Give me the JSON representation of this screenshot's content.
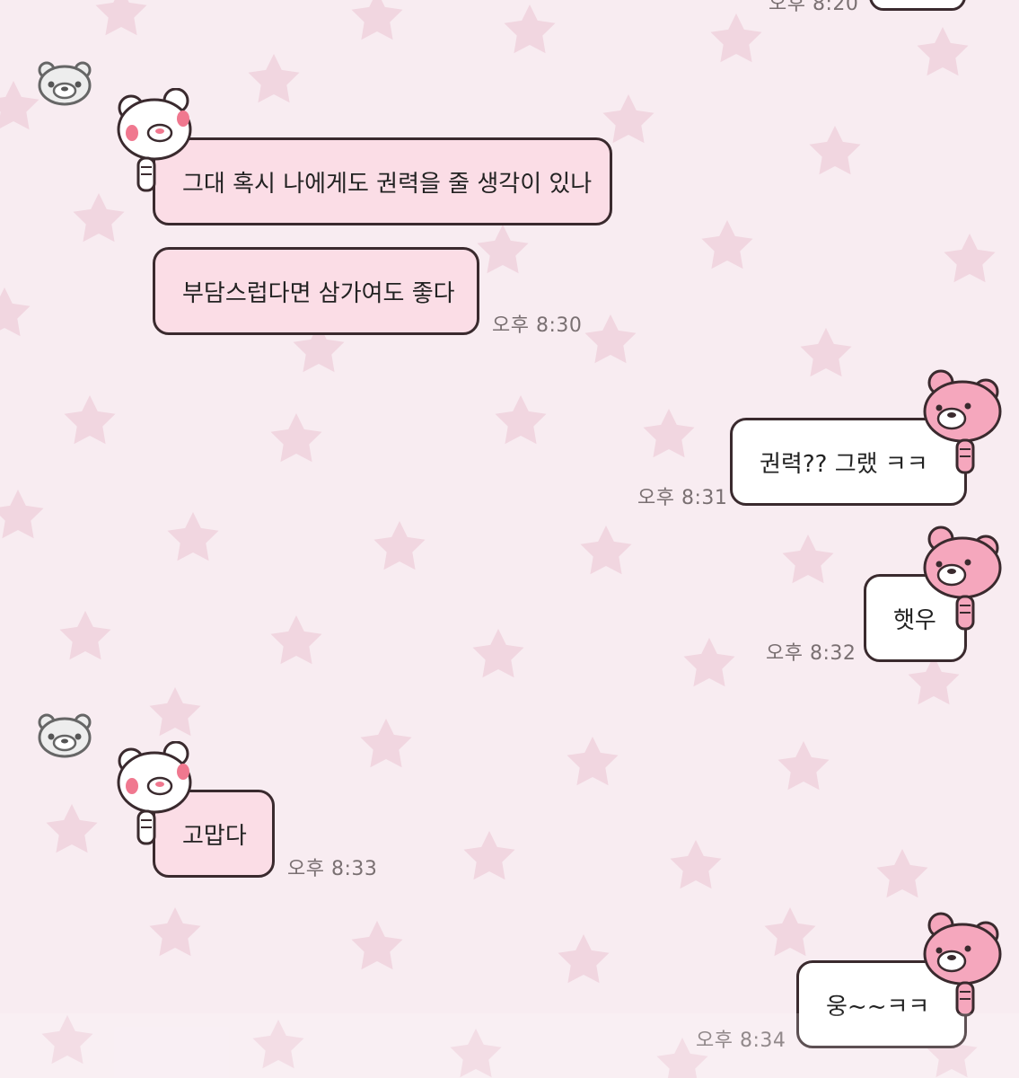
{
  "colors": {
    "background": "#f8ecf1",
    "star": "#f1d6e0",
    "incoming_bubble": "#fbdde6",
    "outgoing_bubble": "#ffffff",
    "bubble_border": "#3a2a2e",
    "timestamp": "#7a7072"
  },
  "header": {
    "partial_time": "오후 8:20"
  },
  "messages": [
    {
      "direction": "incoming",
      "avatar": "gray-bear-avatar-icon",
      "sticker": "white-bear-icon",
      "text": "그대 혹시 나에게도 권력을 줄 생각이 있나",
      "time": ""
    },
    {
      "direction": "incoming",
      "text": "부담스럽다면 삼가여도 좋다",
      "time": "오후 8:30"
    },
    {
      "direction": "outgoing",
      "sticker": "pink-bear-icon",
      "text": "권력?? 그랬 ㅋㅋ",
      "time": "오후 8:31"
    },
    {
      "direction": "outgoing",
      "sticker": "pink-bear-icon",
      "text": "햇우",
      "time": "오후 8:32"
    },
    {
      "direction": "incoming",
      "avatar": "gray-bear-avatar-icon",
      "sticker": "white-bear-icon",
      "text": "고맙다",
      "time": "오후 8:33"
    },
    {
      "direction": "outgoing",
      "sticker": "pink-bear-icon",
      "text": "웅~~ㅋㅋ",
      "time": "오후 8:34"
    }
  ]
}
